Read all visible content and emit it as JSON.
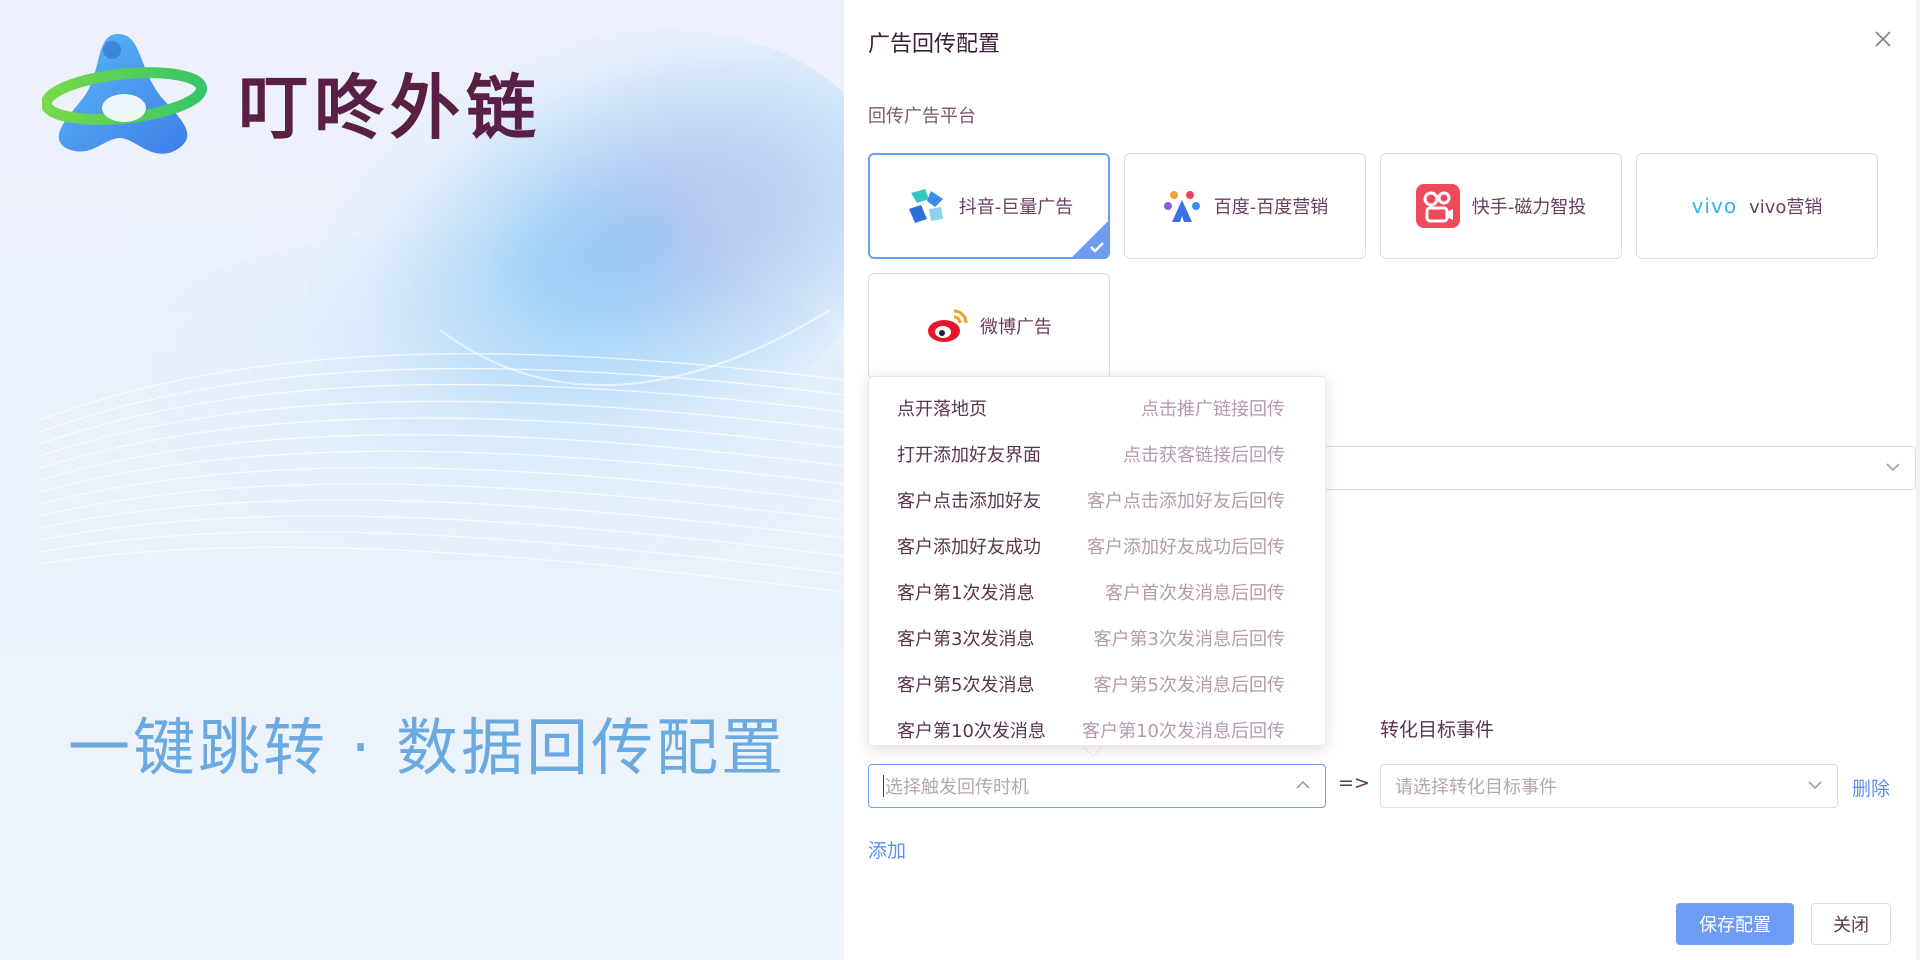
{
  "left": {
    "brand_name": "叮咚外链",
    "slogan": "一键跳转 · 数据回传配置"
  },
  "drawer": {
    "title": "广告回传配置",
    "platform_section_label": "回传广告平台",
    "platforms": [
      {
        "label": "抖音-巨量广告",
        "icon": "ocean-engine-icon",
        "selected": true
      },
      {
        "label": "百度-百度营销",
        "icon": "baidu-marketing-icon",
        "selected": false
      },
      {
        "label": "快手-磁力智投",
        "icon": "kuaishou-icon",
        "selected": false
      },
      {
        "label": "vivo营销",
        "icon": "vivo-icon",
        "icon_text": "vivo",
        "selected": false
      },
      {
        "label": "微博广告",
        "icon": "weibo-icon",
        "selected": false
      }
    ],
    "conversion_label": "转化目标事件",
    "trigger_select": {
      "placeholder": "选择触发回传时机",
      "open": true
    },
    "arrow": "=>",
    "conversion_select": {
      "placeholder": "请选择转化目标事件"
    },
    "delete_label": "删除",
    "add_label": "添加",
    "save_label": "保存配置",
    "close_label": "关闭"
  },
  "dropdown": {
    "options": [
      {
        "main": "点开落地页",
        "sub": "点击推广链接回传"
      },
      {
        "main": "打开添加好友界面",
        "sub": "点击获客链接后回传"
      },
      {
        "main": "客户点击添加好友",
        "sub": "客户点击添加好友后回传"
      },
      {
        "main": "客户添加好友成功",
        "sub": "客户添加好友成功后回传"
      },
      {
        "main": "客户第1次发消息",
        "sub": "客户首次发消息后回传"
      },
      {
        "main": "客户第3次发消息",
        "sub": "客户第3次发消息后回传"
      },
      {
        "main": "客户第5次发消息",
        "sub": "客户第5次发消息后回传"
      },
      {
        "main": "客户第10次发消息",
        "sub": "客户第10次发消息后回传"
      }
    ]
  },
  "colors": {
    "accent": "#6f9bf1",
    "primary_button": "#6e9cf5",
    "brand_text": "#5a1f45",
    "slogan": "#6aaae0",
    "link": "#5b8ff0"
  }
}
